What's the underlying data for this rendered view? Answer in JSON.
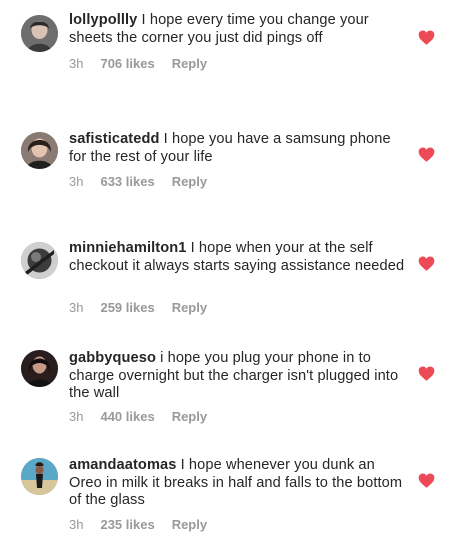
{
  "accent_color": "#ed4956",
  "meta_color": "#999999",
  "comments": [
    {
      "username": "lollypollly",
      "text": " I hope every time you change your sheets the corner you just did pings off",
      "time": "3h",
      "likes": "706 likes",
      "reply": "Reply",
      "icon": "heart-icon"
    },
    {
      "username": "safisticatedd",
      "text": " I hope you have a samsung phone for the rest of your life",
      "time": "3h",
      "likes": "633 likes",
      "reply": "Reply",
      "icon": "heart-icon"
    },
    {
      "username": "minniehamilton1",
      "text": " I hope when your at the self checkout it always starts saying assistance needed",
      "time": "3h",
      "likes": "259 likes",
      "reply": "Reply",
      "icon": "heart-icon"
    },
    {
      "username": "gabbyqueso",
      "text": " i hope you plug your phone in to charge overnight but the charger isn't plugged into the wall",
      "time": "3h",
      "likes": "440 likes",
      "reply": "Reply",
      "icon": "heart-icon"
    },
    {
      "username": "amandaatomas",
      "text": " I hope whenever you dunk an Oreo in milk it breaks in half and falls to the bottom of the glass",
      "time": "3h",
      "likes": "235 likes",
      "reply": "Reply",
      "icon": "heart-icon"
    }
  ]
}
